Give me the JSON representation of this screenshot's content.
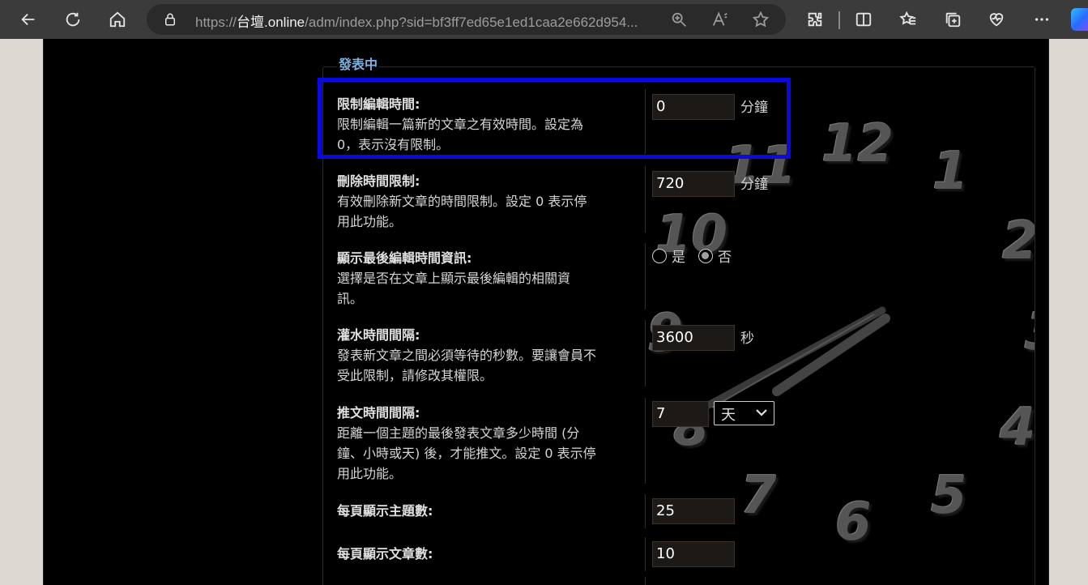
{
  "browser": {
    "url_prefix": "https://",
    "url_host": "台壇.online",
    "url_rest": "/adm/index.php?sid=bf3ff7ed65e1ed1caa2e662d954..."
  },
  "section": {
    "legend": "發表中"
  },
  "clock_numbers": [
    "12",
    "1",
    "2",
    "3",
    "4",
    "5",
    "6",
    "7",
    "8",
    "9",
    "10",
    "11"
  ],
  "settings": [
    {
      "title": "限制編輯時間:",
      "desc_line1": "限制編輯一篇新的文章之有效時間。設定為",
      "desc_line2": "0，表示沒有限制。",
      "value": "0",
      "unit": "分鐘"
    },
    {
      "title": "刪除時間限制:",
      "desc_line1": "有效刪除新文章的時間限制。設定 0 表示停",
      "desc_line2": "用此功能。",
      "value": "720",
      "unit": "分鐘"
    },
    {
      "title": "顯示最後編輯時間資訊:",
      "desc_line1": "選擇是否在文章上顯示最後編輯的相關資",
      "desc_line2": "訊。",
      "option_yes": "是",
      "option_no": "否"
    },
    {
      "title": "灌水時間間隔:",
      "desc_line1": "發表新文章之間必須等待的秒數。要讓會員不",
      "desc_line2": "受此限制，請修改其權限。",
      "value": "3600",
      "unit": "秒"
    },
    {
      "title": "推文時間間隔:",
      "desc_line1": "距離一個主題的最後發表文章多少時間 (分",
      "desc_line2": "鐘、小時或天) 後，才能推文。設定 0 表示停",
      "desc_line3": "用此功能。",
      "value": "7",
      "select_value": "天"
    },
    {
      "title": "每頁顯示主題數:",
      "value": "25"
    },
    {
      "title": "每頁顯示文章數:",
      "value": "10"
    }
  ]
}
